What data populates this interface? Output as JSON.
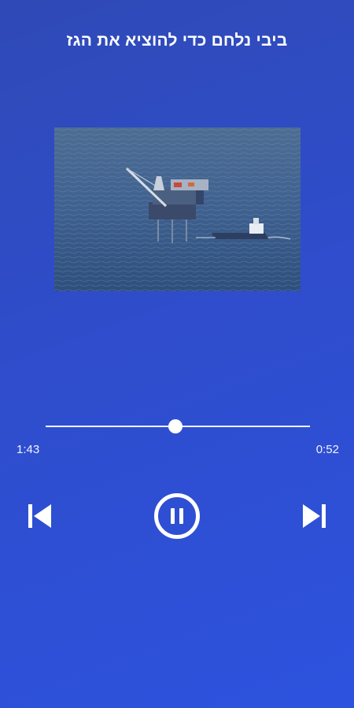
{
  "player": {
    "title": "ביבי נלחם כדי להוציא את הגז",
    "artwork_icon": "offshore-gas-platform-image",
    "elapsed": "1:43",
    "remaining": "0:52",
    "progress_fraction": 0.49
  },
  "controls": {
    "prev_icon": "skip-previous-icon",
    "play_icon": "pause-icon",
    "next_icon": "skip-next-icon"
  },
  "colors": {
    "background_start": "#2f4ab6",
    "background_end": "#2d52de",
    "foreground": "#ffffff"
  }
}
